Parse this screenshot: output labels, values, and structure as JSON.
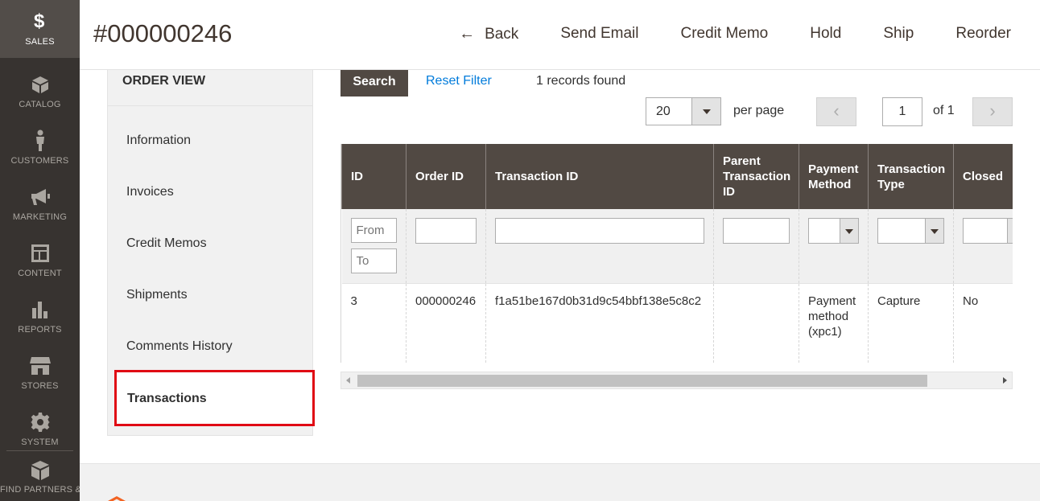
{
  "menu": {
    "items": [
      {
        "label": "Sales",
        "icon": "dollar-icon",
        "active": true
      },
      {
        "label": "Catalog",
        "icon": "box-icon"
      },
      {
        "label": "Customers",
        "icon": "person-icon"
      },
      {
        "label": "Marketing",
        "icon": "megaphone-icon"
      },
      {
        "label": "Content",
        "icon": "layout-icon"
      },
      {
        "label": "Reports",
        "icon": "bar-chart-icon"
      },
      {
        "label": "Stores",
        "icon": "store-icon"
      },
      {
        "label": "System",
        "icon": "gear-icon"
      },
      {
        "label": "Find Partners & Extensions",
        "icon": "cubes-icon"
      }
    ]
  },
  "header": {
    "title": "#000000246",
    "actions": {
      "back": "Back",
      "send_email": "Send Email",
      "credit_memo": "Credit Memo",
      "hold": "Hold",
      "ship": "Ship",
      "reorder": "Reorder"
    }
  },
  "order_nav": {
    "title": "ORDER VIEW",
    "items": [
      "Information",
      "Invoices",
      "Credit Memos",
      "Shipments",
      "Comments History",
      "Transactions"
    ],
    "active": "Transactions"
  },
  "grid": {
    "search_label": "Search",
    "reset_filter_label": "Reset Filter",
    "records_found": "1 records found",
    "per_page_value": "20",
    "per_page_label": "per page",
    "current_page": "1",
    "page_of": "of 1",
    "columns": [
      "ID",
      "Order ID",
      "Transaction ID",
      "Parent Transaction ID",
      "Payment Method",
      "Transaction Type",
      "Closed"
    ],
    "filters": {
      "id_from_placeholder": "From",
      "id_to_placeholder": "To"
    },
    "rows": [
      {
        "id": "3",
        "order_id": "000000246",
        "transaction_id": "f1a51be167d0b31d9c54bbf138e5c8c2",
        "parent_transaction_id": "",
        "payment_method": "Payment method (xpc1)",
        "transaction_type": "Capture",
        "closed": "No"
      }
    ]
  },
  "colors": {
    "menu_bg": "#373330",
    "menu_active_bg": "#524d49",
    "grid_header_bg": "#514943",
    "link": "#007bdb",
    "highlight": "#e00a14"
  }
}
